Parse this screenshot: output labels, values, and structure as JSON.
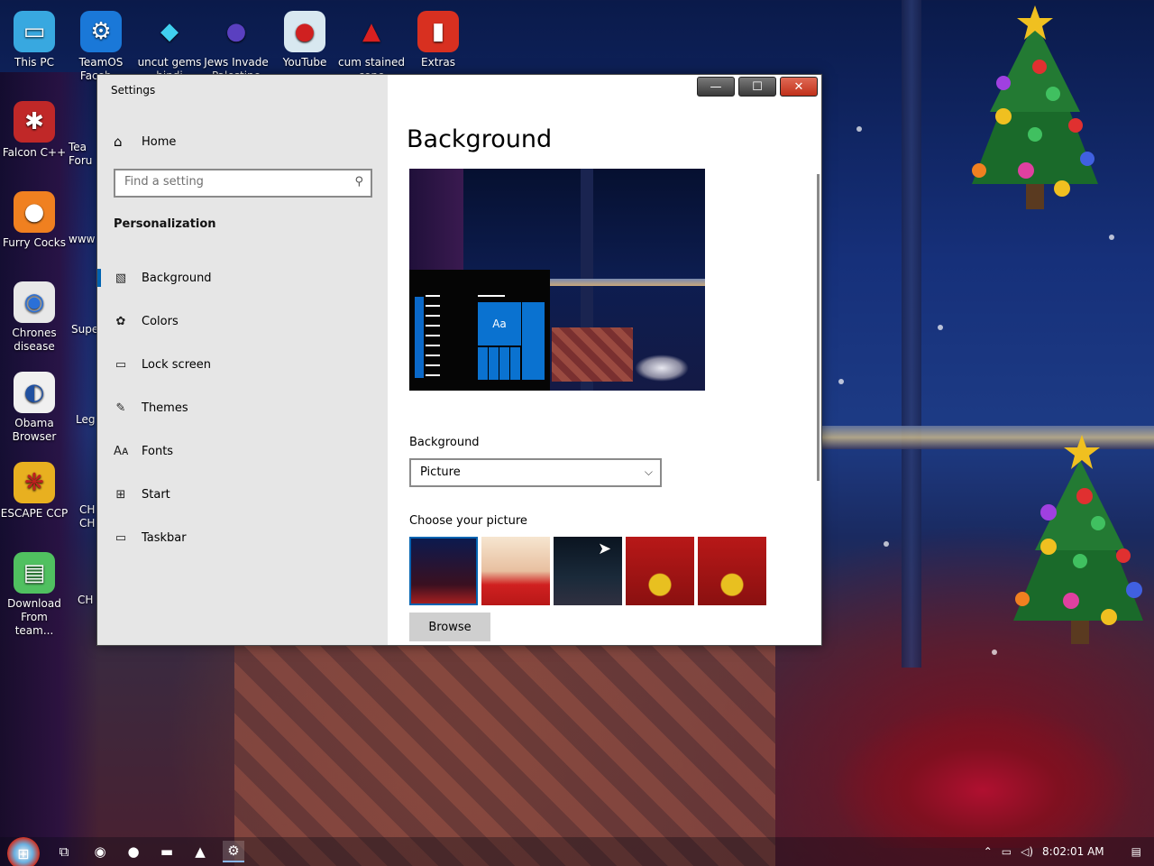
{
  "desktop": {
    "icons": [
      {
        "label": "This PC",
        "icon": "monitor-icon",
        "glyph": "▭",
        "bg": "#38a8e0"
      },
      {
        "label": "TeamOS Faceb...",
        "icon": "gear-icon",
        "glyph": "⚙",
        "bg": "#1a78d8"
      },
      {
        "label": "uncut gems hindi",
        "icon": "diamond-icon",
        "glyph": "◆",
        "bg": "transparent",
        "fg": "#40d0f0"
      },
      {
        "label": "Jews Invade Palestine",
        "icon": "ornament-icon",
        "glyph": "●",
        "bg": "transparent",
        "fg": "#5a40c0"
      },
      {
        "label": "YouTube",
        "icon": "angry-bird-icon",
        "glyph": "●",
        "bg": "#d8e8f0",
        "fg": "#d02020"
      },
      {
        "label": "cum stained cone",
        "icon": "santa-icon",
        "glyph": "▲",
        "bg": "transparent",
        "fg": "#d82020"
      },
      {
        "label": "Extras",
        "icon": "door-icon",
        "glyph": "▮",
        "bg": "#d83020",
        "fg": "#fff"
      },
      {
        "label": "Falcon C++",
        "icon": "ornament-icon",
        "glyph": "✱",
        "bg": "#c02828"
      },
      {
        "label": "Furry Cocks",
        "icon": "firefox-icon",
        "glyph": "●",
        "bg": "#f08020"
      },
      {
        "label": "Chrones disease",
        "icon": "chrome-icon",
        "glyph": "◉",
        "bg": "#e8e8e8",
        "fg": "#2a70d8"
      },
      {
        "label": "Obama Browser",
        "icon": "obama-logo-icon",
        "glyph": "◐",
        "bg": "#f0f0f0",
        "fg": "#2050a0"
      },
      {
        "label": "ESCAPE CCP",
        "icon": "ccp-icon",
        "glyph": "❋",
        "bg": "#e8b020",
        "fg": "#c02020"
      },
      {
        "label": "Download From team...",
        "icon": "notepad-icon",
        "glyph": "▤",
        "bg": "#50c060"
      }
    ],
    "partial_labels": [
      "Tea Foru",
      "www",
      "Supe",
      "Leg Z",
      "CH CH",
      "CH C"
    ]
  },
  "window": {
    "title": "Settings",
    "controls": {
      "minimize": "—",
      "maximize": "☐",
      "close": "✕"
    },
    "sidebar": {
      "home_label": "Home",
      "search_placeholder": "Find a setting",
      "section_title": "Personalization",
      "items": [
        {
          "label": "Background",
          "icon": "image-icon",
          "glyph": "▧",
          "active": true
        },
        {
          "label": "Colors",
          "icon": "palette-icon",
          "glyph": "✿",
          "active": false
        },
        {
          "label": "Lock screen",
          "icon": "lock-screen-icon",
          "glyph": "▭",
          "active": false
        },
        {
          "label": "Themes",
          "icon": "brush-icon",
          "glyph": "✎",
          "active": false
        },
        {
          "label": "Fonts",
          "icon": "font-icon",
          "glyph": "Aᴀ",
          "active": false
        },
        {
          "label": "Start",
          "icon": "start-icon",
          "glyph": "⊞",
          "active": false
        },
        {
          "label": "Taskbar",
          "icon": "taskbar-icon",
          "glyph": "▭",
          "active": false
        }
      ]
    },
    "main": {
      "title": "Background",
      "preview_tile_text": "Aa",
      "background_label": "Background",
      "background_value": "Picture",
      "choose_label": "Choose your picture",
      "pictures": [
        "candles",
        "santa-meme",
        "dark-car",
        "minions-christmas",
        "minions-christmas-2"
      ],
      "browse_label": "Browse"
    }
  },
  "taskbar": {
    "time": "8:02:01 AM",
    "pinned": [
      {
        "icon": "task-view-icon",
        "glyph": "⧉"
      },
      {
        "icon": "chrome-icon",
        "glyph": "◉"
      },
      {
        "icon": "firefox-icon",
        "glyph": "●"
      },
      {
        "icon": "file-explorer-icon",
        "glyph": "▬"
      },
      {
        "icon": "app-icon",
        "glyph": "▲"
      },
      {
        "icon": "settings-icon",
        "glyph": "⚙"
      }
    ]
  },
  "colors": {
    "accent": "#0063b1",
    "close": "#c0301a"
  }
}
